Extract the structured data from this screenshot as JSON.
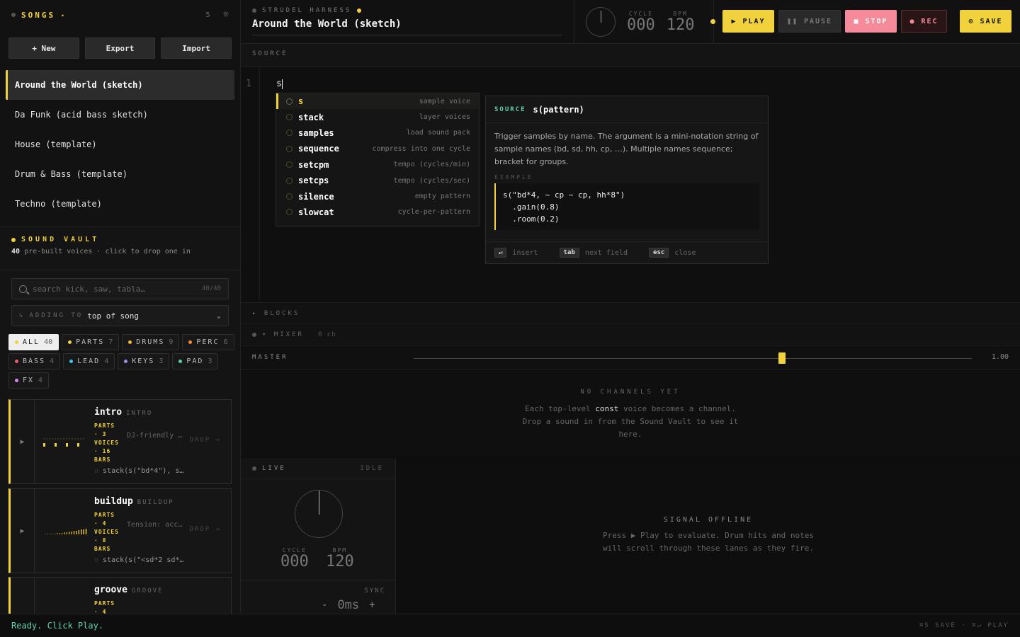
{
  "sidebar": {
    "title": "SONGS",
    "count": "5",
    "buttons": {
      "new": "+ New",
      "export": "Export",
      "import": "Import"
    },
    "songs": [
      "Around the World (sketch)",
      "Da Funk (acid bass sketch)",
      "House (template)",
      "Drum & Bass (template)",
      "Techno (template)"
    ]
  },
  "vault": {
    "title": "SOUND VAULT",
    "count": "40",
    "subtitle": "pre-built voices · click to drop one in",
    "search_placeholder": "search kick, saw, tabla…",
    "search_count": "40/40",
    "adding_label": "ADDING TO",
    "adding_value": "top of song",
    "chips": [
      {
        "label": "ALL",
        "count": "40",
        "color": "#f2d23c"
      },
      {
        "label": "PARTS",
        "count": "7",
        "color": "#f2d23c"
      },
      {
        "label": "DRUMS",
        "count": "9",
        "color": "#f2b43c"
      },
      {
        "label": "PERC",
        "count": "6",
        "color": "#f28a3c"
      },
      {
        "label": "BASS",
        "count": "4",
        "color": "#f25a6a"
      },
      {
        "label": "LEAD",
        "count": "4",
        "color": "#3cc8f2"
      },
      {
        "label": "KEYS",
        "count": "3",
        "color": "#a88af2"
      },
      {
        "label": "PAD",
        "count": "3",
        "color": "#5fd3a8"
      },
      {
        "label": "FX",
        "count": "4",
        "color": "#d28af2"
      }
    ],
    "cards": [
      {
        "name": "intro",
        "tag": "INTRO",
        "meta": "PARTS\n· 3\nVOICES\n· 16\nBARS",
        "desc": "DJ-friendly intro",
        "code": "stack(s(\"bd*4\"), s(\"hh*8\"))"
      },
      {
        "name": "buildup",
        "tag": "BUILDUP",
        "meta": "PARTS\n· 4\nVOICES\n· 8\nBARS",
        "desc": "Tension: accelerating",
        "code": "stack(s(\"<sd*2 sd*4 sd*8>\"))"
      },
      {
        "name": "groove",
        "tag": "GROOVE",
        "meta": "PARTS\n· 4",
        "desc": "",
        "code": ""
      }
    ],
    "drop_label": "DROP →"
  },
  "topbar": {
    "harness": "STRUDEL HARNESS",
    "song_title": "Around the World (sketch)",
    "cycle_label": "CYCLE",
    "cycle": "000",
    "bpm_label": "BPM",
    "bpm": "120",
    "play": "▶ PLAY",
    "pause": "❚❚ PAUSE",
    "stop": "■ STOP",
    "rec": "● REC",
    "save": "⊙ SAVE"
  },
  "editor": {
    "label": "SOURCE",
    "line_no": "1",
    "code": "s",
    "autocomplete": [
      {
        "name": "s",
        "desc": "sample voice"
      },
      {
        "name": "stack",
        "desc": "layer voices"
      },
      {
        "name": "samples",
        "desc": "load sound pack"
      },
      {
        "name": "sequence",
        "desc": "compress into one cycle"
      },
      {
        "name": "setcpm",
        "desc": "tempo (cycles/min)"
      },
      {
        "name": "setcps",
        "desc": "tempo (cycles/sec)"
      },
      {
        "name": "silence",
        "desc": "empty pattern"
      },
      {
        "name": "slowcat",
        "desc": "cycle-per-pattern"
      }
    ],
    "doc": {
      "kind": "SOURCE",
      "signature": "s(pattern)",
      "text": "Trigger samples by name. The argument is a mini-notation string of sample names (bd, sd, hh, cp, …). Multiple names sequence; bracket for groups.",
      "example_label": "EXAMPLE",
      "example": "s(\"bd*4, ~ cp ~ cp, hh*8\")\n  .gain(0.8)\n  .room(0.2)",
      "keys": [
        {
          "key": "↵",
          "label": "insert"
        },
        {
          "key": "tab",
          "label": "next field"
        },
        {
          "key": "esc",
          "label": "close"
        }
      ]
    }
  },
  "blocks": {
    "label": "▸ BLOCKS"
  },
  "mixer": {
    "label": "▾ MIXER",
    "count": "0 ch",
    "master_label": "MASTER",
    "master_value": "1.00",
    "master_level": 0.66
  },
  "channels": {
    "title": "NO CHANNELS YET",
    "desc_pre": "Each top-level ",
    "desc_kw": "const",
    "desc_post": " voice becomes a channel. Drop a sound in from the Sound Vault to see it here."
  },
  "live": {
    "label": "LIVE",
    "state": "IDLE",
    "cycle_label": "CYCLE",
    "cycle": "000",
    "bpm_label": "BPM",
    "bpm": "120",
    "sync_label": "SYNC",
    "sync_minus": "-",
    "sync_value": "0ms",
    "sync_plus": "+"
  },
  "signal": {
    "title": "SIGNAL OFFLINE",
    "desc": "Press ▶ Play to evaluate. Drum hits and notes will scroll through these lanes as they fire."
  },
  "status": {
    "message": "Ready. Click Play.",
    "hint": "⌘S SAVE · ⌘↵ PLAY"
  }
}
